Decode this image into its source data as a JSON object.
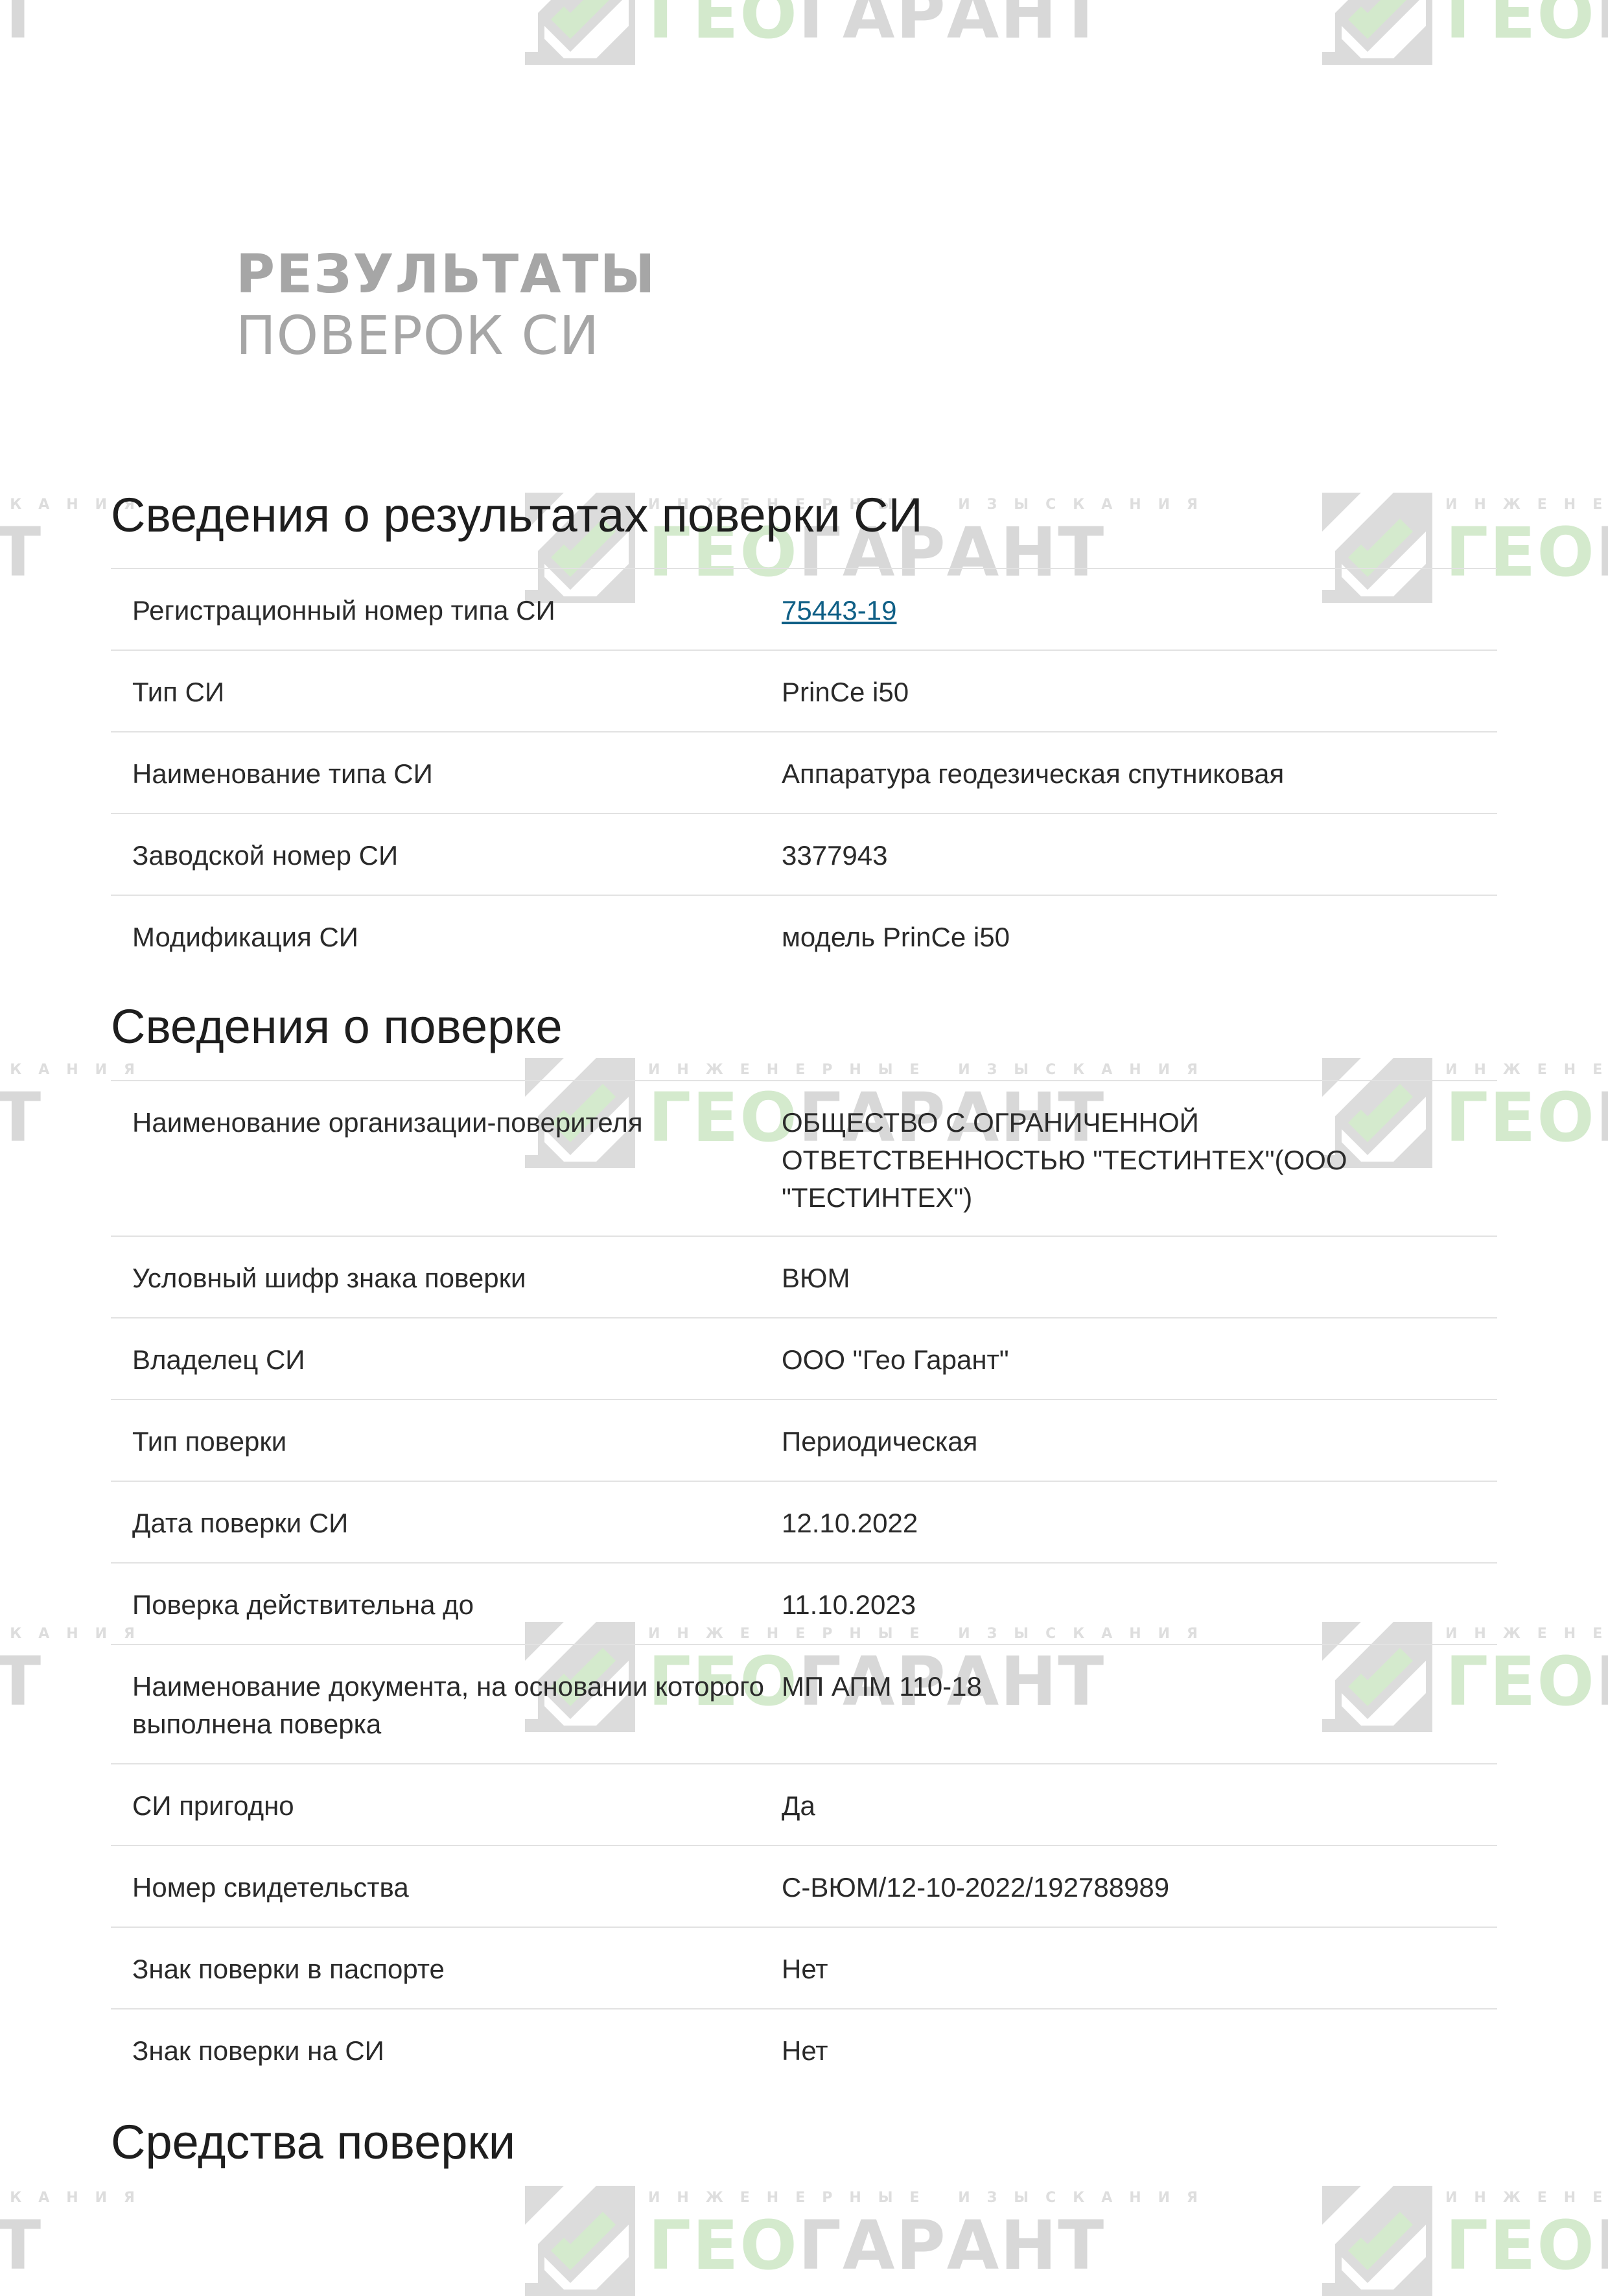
{
  "watermark": {
    "tagline": "ИНЖЕНЕРНЫЕ ИЗЫСКАНИЯ",
    "name_part1": "ГЕО",
    "name_part2": "ГАРАНТ",
    "colors": {
      "green": "#9fd08f",
      "gray": "#a9a9a9"
    }
  },
  "hero": {
    "line1": "РЕЗУЛЬТАТЫ",
    "line2": "ПОВЕРОК СИ"
  },
  "sections": {
    "si": {
      "title": "Сведения о результатах поверки СИ",
      "rows": [
        {
          "label": "Регистрационный номер типа СИ",
          "value": "75443-19",
          "is_link": true
        },
        {
          "label": "Тип СИ",
          "value": "PrinCe i50"
        },
        {
          "label": "Наименование типа СИ",
          "value": "Аппаратура геодезическая спутниковая"
        },
        {
          "label": "Заводской номер СИ",
          "value": "3377943"
        },
        {
          "label": "Модификация СИ",
          "value": "модель PrinCe i50"
        }
      ]
    },
    "verification": {
      "title": "Сведения о поверке",
      "rows": [
        {
          "label": "Наименование организации-поверителя",
          "value": "ОБЩЕСТВО С ОГРАНИЧЕННОЙ ОТВЕТСТВЕННОСТЬЮ \"ТЕСТИНТЕХ\"(ООО \"ТЕСТИНТЕХ\")"
        },
        {
          "label": "Условный шифр знака поверки",
          "value": "ВЮМ"
        },
        {
          "label": "Владелец СИ",
          "value": "ООО \"Гео Гарант\""
        },
        {
          "label": "Тип поверки",
          "value": "Периодическая"
        },
        {
          "label": "Дата поверки СИ",
          "value": "12.10.2022"
        },
        {
          "label": "Поверка действительна до",
          "value": "11.10.2023"
        },
        {
          "label": "Наименование документа, на основании которого выполнена поверка",
          "value": "МП АПМ 110-18"
        },
        {
          "label": "СИ пригодно",
          "value": "Да"
        },
        {
          "label": "Номер свидетельства",
          "value": "С-ВЮМ/12-10-2022/192788989"
        },
        {
          "label": "Знак поверки в паспорте",
          "value": "Нет"
        },
        {
          "label": "Знак поверки на СИ",
          "value": "Нет"
        }
      ]
    },
    "tools": {
      "title": "Средства поверки"
    }
  }
}
